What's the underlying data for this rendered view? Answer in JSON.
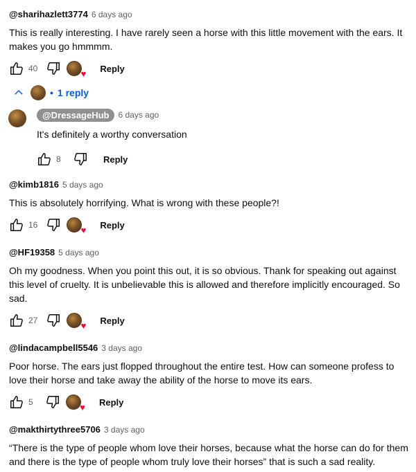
{
  "comments": [
    {
      "author": "@sharihazlett3774",
      "time": "6 days ago",
      "text_lines": [
        "This is really interesting. I have rarely seen a horse with this little movement with the ears. It",
        "makes you go hmmmm."
      ],
      "likes": "40",
      "reply_label": "Reply"
    },
    {
      "author": "@kimb1816",
      "time": "5 days ago",
      "text_lines": [
        "This is absolutely horrifying.  What is wrong with these people?!"
      ],
      "likes": "16",
      "reply_label": "Reply"
    },
    {
      "author": "@HF19358",
      "time": "5 days ago",
      "text_lines": [
        "Oh my goodness. When you point this out,  it is so obvious.   Thank for speaking out against",
        "this level of cruelty.  It is unbelievable this is allowed and therefore implicitly encouraged. So",
        "sad."
      ],
      "likes": "27",
      "reply_label": "Reply"
    },
    {
      "author": "@lindacampbell5546",
      "time": "3 days ago",
      "text_lines": [
        "Poor horse.  The ears just flopped throughout the entire test. How can someone  profess to",
        "love their horse and take away the ability of the horse to move its ears."
      ],
      "likes": "5",
      "reply_label": "Reply"
    },
    {
      "author": "@makthirtythree5706",
      "time": "3 days ago",
      "text_lines": [
        "“There is the type of people whom love their horses, because what the horse can do for them",
        "and there is the type of people whom truly love their horses” that is such a sad reality."
      ]
    }
  ],
  "replies_toggle": {
    "dot": "•",
    "label": "1 reply"
  },
  "reply": {
    "author": "@DressageHub",
    "time": "6 days ago",
    "text": "It's definitely a worthy conversation",
    "likes": "8",
    "reply_label": "Reply"
  },
  "icons": {
    "like": "thumbs-up-icon",
    "dislike": "thumbs-down-icon",
    "creator_heart": "creator-heart-icon",
    "collapse": "chevron-up-icon",
    "heart_color": "#ff0033",
    "link_color": "#065fd4"
  }
}
